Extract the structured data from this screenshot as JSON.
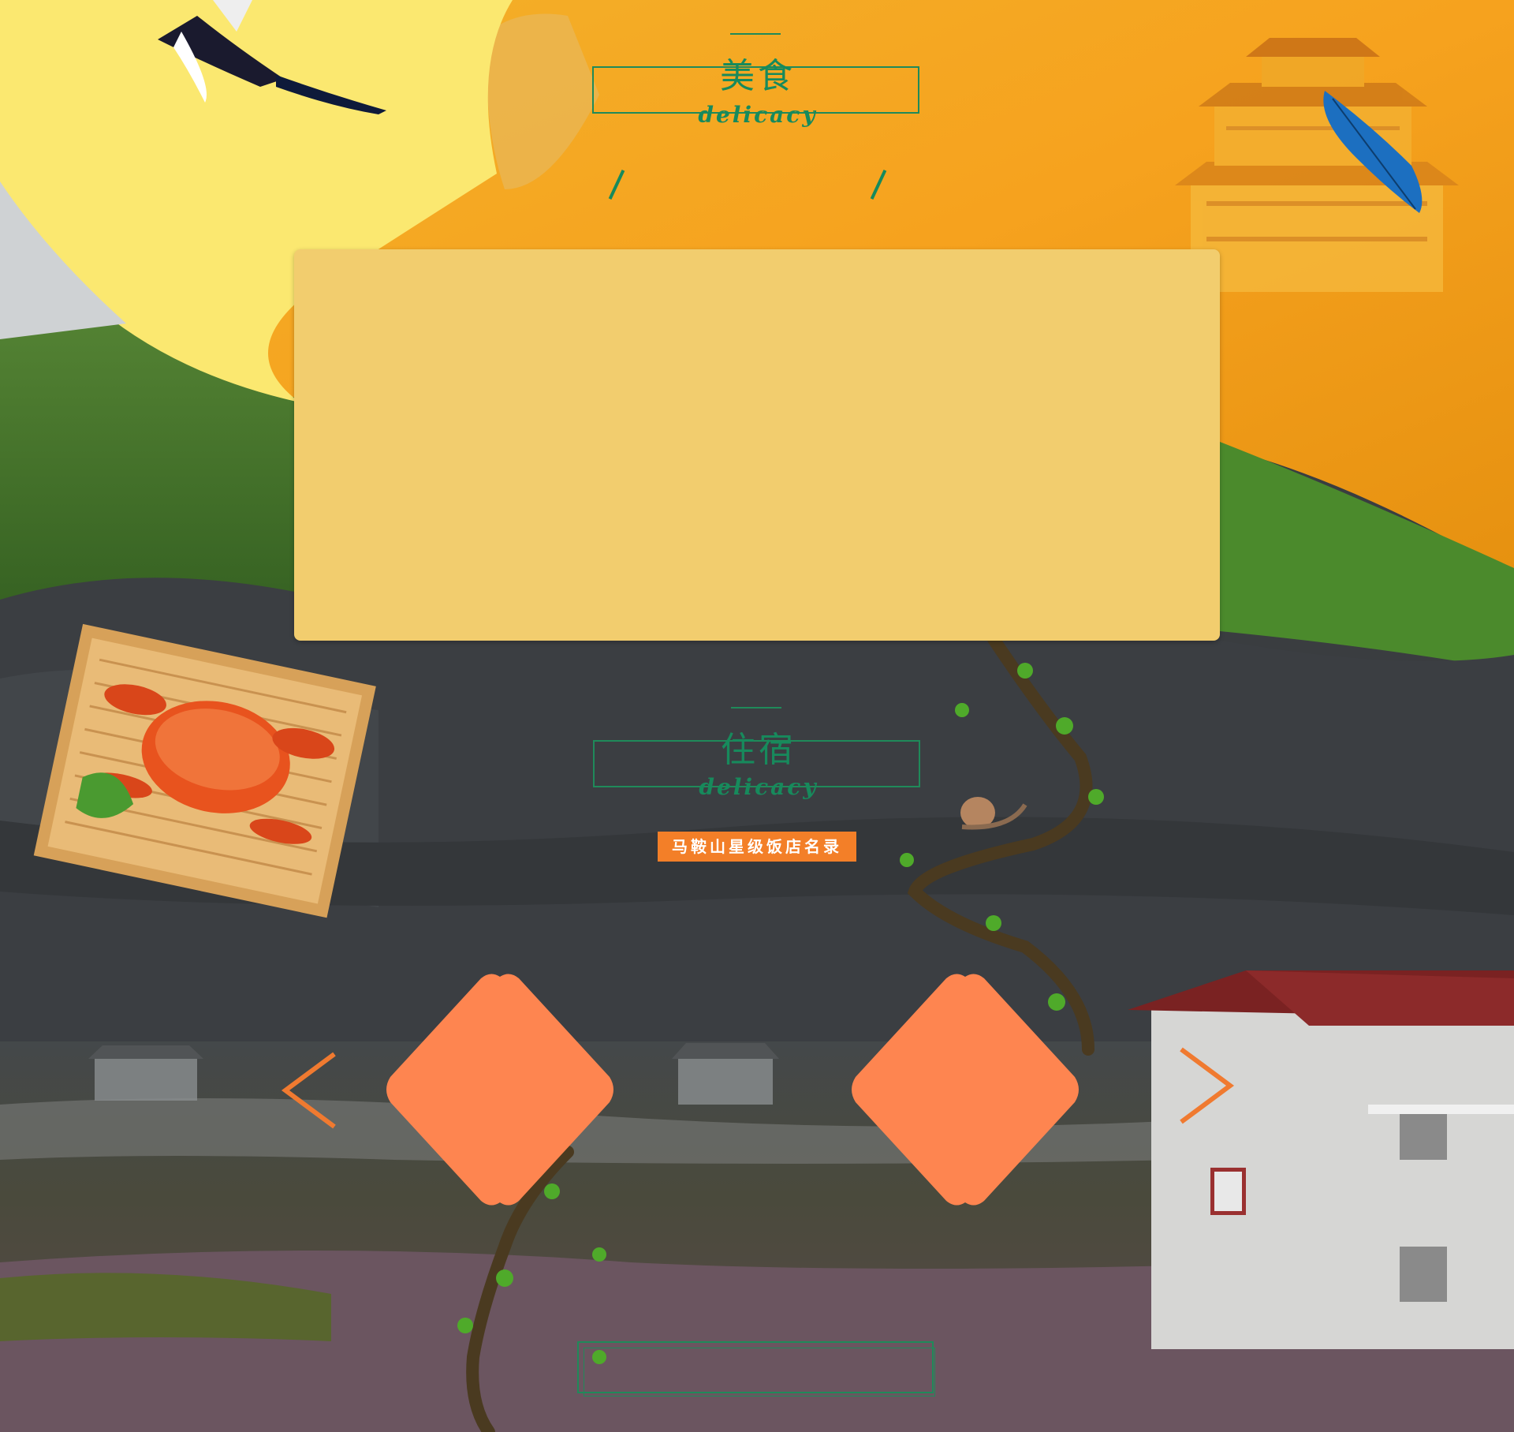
{
  "sections": {
    "food": {
      "title_zh": "美食",
      "title_en": "delicacy"
    },
    "lodging": {
      "title_zh": "住宿",
      "title_en": "delicacy",
      "button_label": "马鞍山星级饭店名录"
    }
  },
  "carousel": {
    "prev_icon": "chevron-left-icon",
    "next_icon": "chevron-right-icon"
  },
  "colors": {
    "accent_green": "#178a5c",
    "card_yellow": "#f2cd6e",
    "button_orange": "#f37f28",
    "diamond_orange": "#fe8550",
    "dark_bg": "#3a3d40"
  }
}
